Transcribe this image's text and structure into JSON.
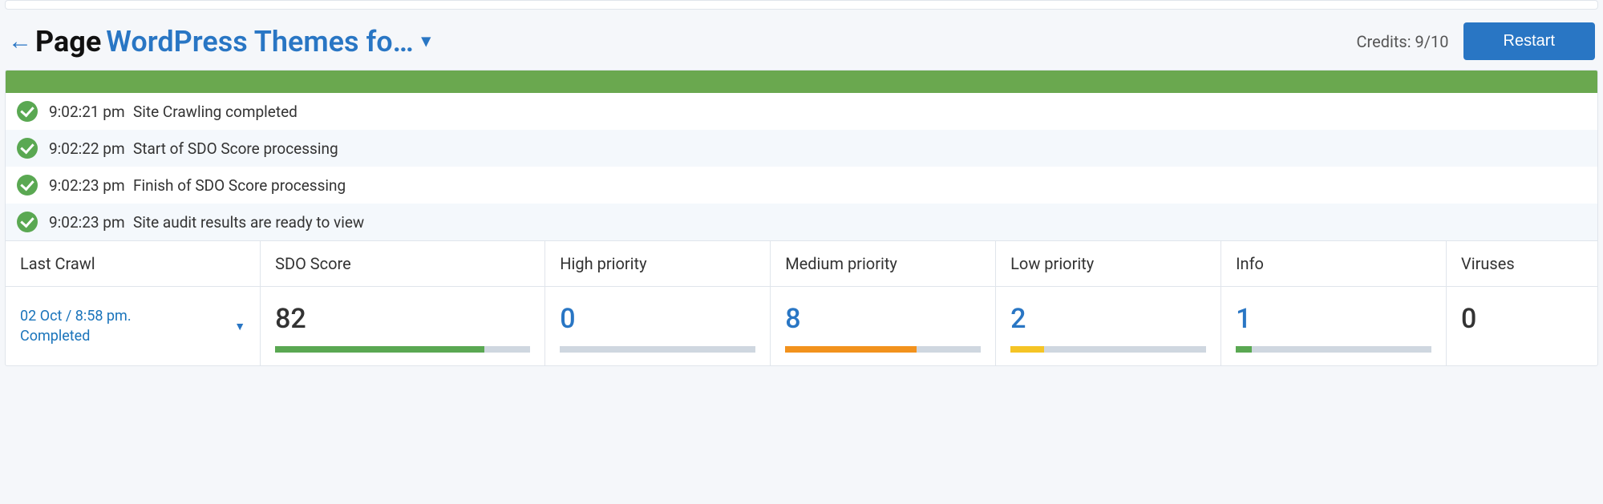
{
  "header": {
    "prefix": "Page",
    "title_link": "WordPress Themes fo…",
    "credits_label": "Credits: 9/10",
    "restart_label": "Restart"
  },
  "logs": [
    {
      "time": "9:02:21 pm",
      "msg": "Site Crawling completed"
    },
    {
      "time": "9:02:22 pm",
      "msg": "Start of SDO Score processing"
    },
    {
      "time": "9:02:23 pm",
      "msg": "Finish of SDO Score processing"
    },
    {
      "time": "9:02:23 pm",
      "msg": "Site audit results are ready to view"
    }
  ],
  "columns": {
    "last_crawl": "Last Crawl",
    "sdo_score": "SDO Score",
    "high": "High priority",
    "medium": "Medium priority",
    "low": "Low priority",
    "info": "Info",
    "viruses": "Viruses"
  },
  "last_crawl": {
    "line1": "02 Oct / 8:58 pm.",
    "line2": "Completed"
  },
  "metrics": {
    "sdo_score": "82",
    "high": "0",
    "medium": "8",
    "low": "2",
    "info": "1",
    "viruses": "0"
  },
  "progress": {
    "sdo_score": 82,
    "high": 0,
    "medium": 67,
    "low": 17,
    "info": 8
  }
}
